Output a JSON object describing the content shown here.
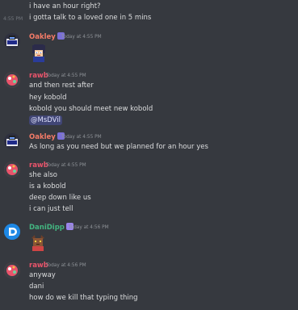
{
  "colors": {
    "background": "#36393f",
    "oakley_name": "#f47b67",
    "rawb_name": "#e9546b",
    "danidipp_name": "#43b581",
    "mention_bg": "#414675"
  },
  "messages": [
    {
      "id": "m0",
      "lines": [
        "i have an hour right?",
        "i gotta talk to a loved one in 5 mins"
      ],
      "inline_time": "4:55 PM"
    },
    {
      "id": "m1",
      "author": "Oakley",
      "time": "Today at 4:55 PM",
      "badge": "badge-icon",
      "content": "sticker-icon"
    },
    {
      "id": "m2",
      "author": "rawb",
      "time": "Today at 4:55 PM",
      "lines": [
        "and then rest after",
        "hey kobold",
        "kobold you should meet new kobold"
      ],
      "mention": "@MsDVil"
    },
    {
      "id": "m3",
      "author": "Oakley",
      "time": "Today at 4:55 PM",
      "lines": [
        "As long as you need but we planned for an hour yes"
      ]
    },
    {
      "id": "m4",
      "author": "rawb",
      "time": "Today at 4:55 PM",
      "lines": [
        "she also",
        "is a kobold",
        "deep down like us",
        "i can just tell"
      ]
    },
    {
      "id": "m5",
      "author": "DaniDipp",
      "time": "Today at 4:56 PM",
      "content": "kobold-emoji"
    },
    {
      "id": "m6",
      "author": "rawb",
      "time": "Today at 4:56 PM",
      "lines": [
        "anyway",
        "dani",
        "how do we kill that typing thing"
      ]
    }
  ]
}
